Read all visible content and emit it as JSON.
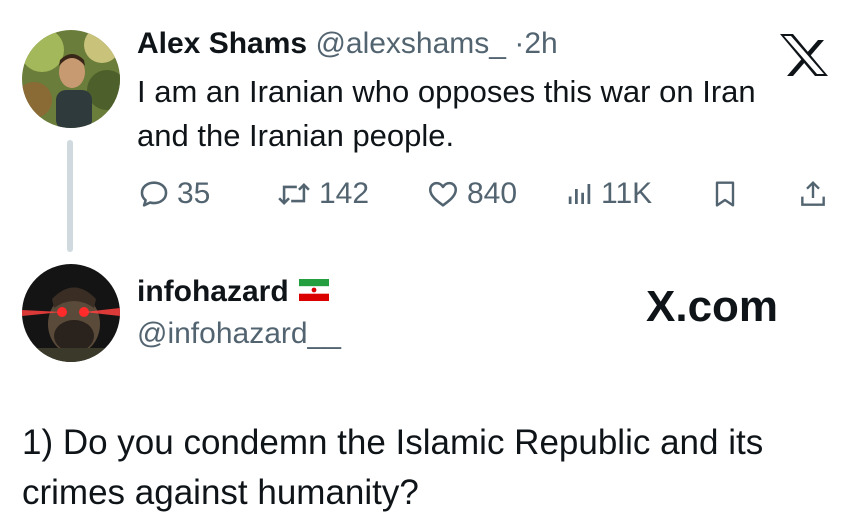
{
  "tweet": {
    "author_name": "Alex Shams",
    "handle": "@alexshams_",
    "separator": "·",
    "time": "2h",
    "text": "I am an Iranian who opposes this war on Iran and the Iranian people.",
    "stats": {
      "replies": "35",
      "reposts": "142",
      "likes": "840",
      "views": "11K"
    }
  },
  "reply": {
    "author_name": "infohazard",
    "handle": "@infohazard__",
    "flag": "iran-flag",
    "watermark": "X.com",
    "text": "1) Do you condemn the Islamic Republic and its crimes against humanity?"
  },
  "icons": {
    "logo": "x-logo-icon",
    "reply": "reply-icon",
    "repost": "repost-icon",
    "like": "heart-icon",
    "views": "views-icon",
    "bookmark": "bookmark-icon",
    "share": "share-icon"
  },
  "colors": {
    "text": "#0f1419",
    "muted": "#536471",
    "thread_line": "#cfd9de"
  }
}
